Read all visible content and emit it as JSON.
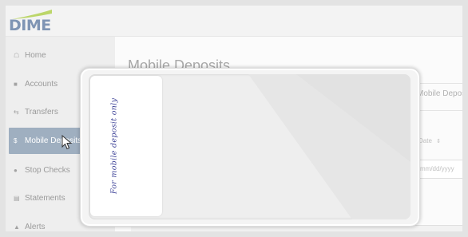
{
  "brand": {
    "logo_text": "DIME",
    "color": "#7f95b4"
  },
  "sidebar": {
    "items": [
      {
        "label": "Home",
        "icon": "home-icon",
        "active": false
      },
      {
        "label": "Accounts",
        "icon": "accounts-icon",
        "active": false
      },
      {
        "label": "Transfers",
        "icon": "transfers-icon",
        "active": false
      },
      {
        "label": "Mobile Deposits",
        "icon": "dollar-icon",
        "active": true
      },
      {
        "label": "Stop Checks",
        "icon": "stop-icon",
        "active": false
      },
      {
        "label": "Statements",
        "icon": "statements-icon",
        "active": false
      },
      {
        "label": "Alerts",
        "icon": "bell-icon",
        "active": false
      }
    ],
    "active_color": "#9fafc0"
  },
  "main": {
    "page_title": "Mobile Deposits",
    "column_title": "Mobile Deposits",
    "date_label": "Date",
    "date_placeholder": "mm/dd/yyyy"
  },
  "overlay": {
    "check_endorsement": "For mobile deposit only",
    "ink_color": "#3a3f96"
  }
}
